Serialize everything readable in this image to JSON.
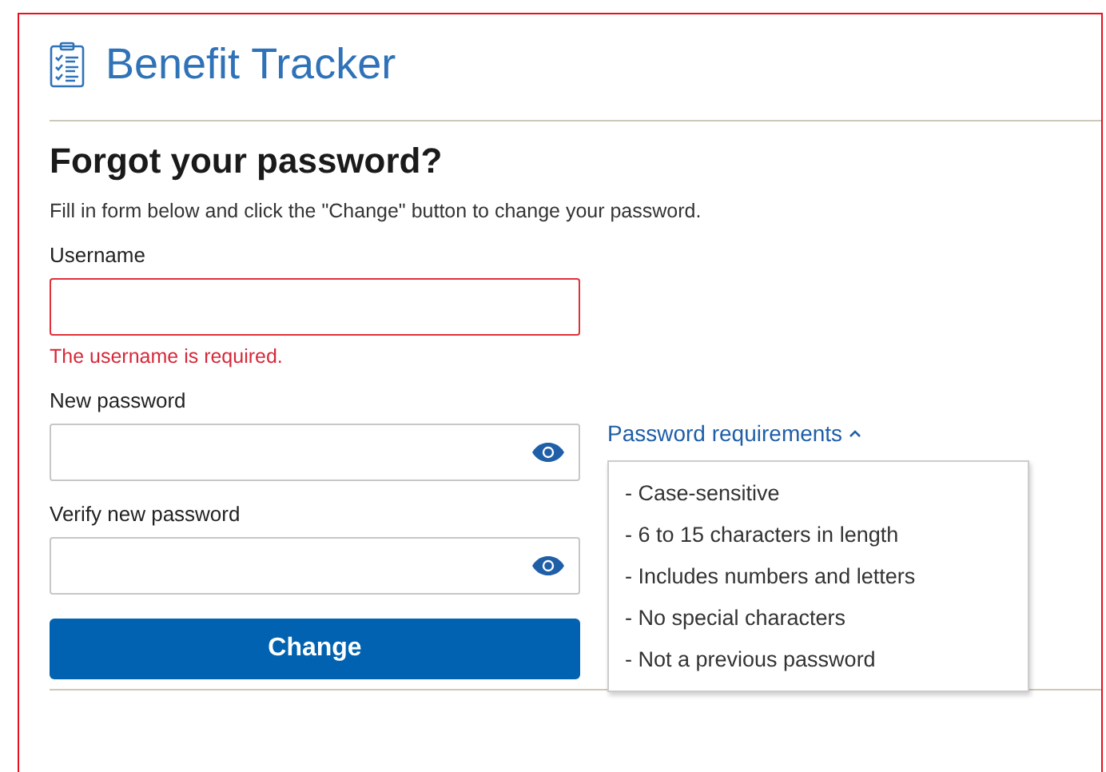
{
  "header": {
    "title": "Benefit Tracker"
  },
  "form": {
    "heading": "Forgot your password?",
    "instructions": "Fill in form below and click the \"Change\" button to change your password.",
    "fields": [
      {
        "label": "Username",
        "kind": "text",
        "error": "The username is required."
      },
      {
        "label": "New password",
        "kind": "password"
      },
      {
        "label": "Verify new password",
        "kind": "password"
      }
    ],
    "submit": "Change"
  },
  "requirements": {
    "label": "Password requirements",
    "expanded": true,
    "items": [
      "- Case-sensitive",
      "- 6 to 15 characters in length",
      "- Includes numbers and letters",
      "- No special characters",
      "- Not a previous password"
    ]
  }
}
